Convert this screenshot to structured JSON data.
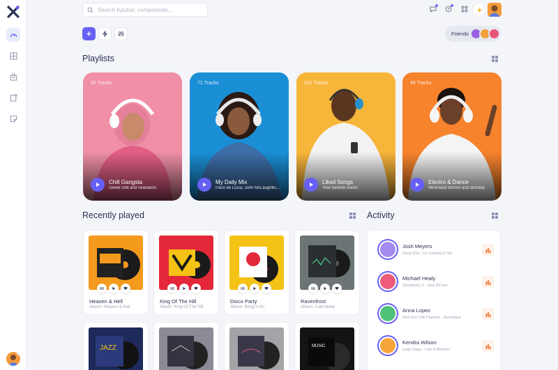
{
  "search": {
    "placeholder": "Search Kputse, components..."
  },
  "header": {
    "friends_label": "Friends"
  },
  "colors": {
    "accent": "#6660f5",
    "background": "#f4f5f9",
    "text": "#283252",
    "muted": "#a2a5b9",
    "eq_orange": "#f07a2d"
  },
  "sidebar": {
    "items": [
      {
        "icon": "gauge-icon",
        "active": true
      },
      {
        "icon": "grid-table-icon",
        "active": false
      },
      {
        "icon": "building-icon",
        "active": false
      },
      {
        "icon": "note-icon",
        "active": false
      },
      {
        "icon": "sticky-note-icon",
        "active": false
      }
    ]
  },
  "toolbar": {
    "icons": [
      "plus-icon",
      "bolt-icon",
      "sliders-icon"
    ]
  },
  "playlists": {
    "title": "Playlists",
    "cards": [
      {
        "tracks": "32 Tracks",
        "name": "Chill Gangsta",
        "sub": "Sweet chill and relaxation",
        "color": "#f08fa6"
      },
      {
        "tracks": "71 Tracks",
        "name": "My Daily Mix",
        "sub": "Paco de Lucia, John McLaughlin,...",
        "color": "#1a8fd6"
      },
      {
        "tracks": "321 Tracks",
        "name": "Liked Songs",
        "sub": "Your favorite tracks",
        "color": "#f7b53a"
      },
      {
        "tracks": "49 Tracks",
        "name": "Electro & Dance",
        "sub": "Minimalist techno and dubstep",
        "color": "#f7832d"
      }
    ]
  },
  "recent": {
    "title": "Recently played",
    "cards": [
      {
        "title": "Heaven & Hell",
        "album": "Album: Heaven & Hell",
        "bg": "#f49a1c"
      },
      {
        "title": "King Of The Hill",
        "album": "Album: King Of The Hill",
        "bg": "#e4283a"
      },
      {
        "title": "Disco Party",
        "album": "Album: Bring It On",
        "bg": "#f5c216"
      },
      {
        "title": "Ravenfrost",
        "album": "Album: Cold Metal",
        "bg": "#6c7476"
      }
    ],
    "more": [
      {
        "bg": "#1f2a5c"
      },
      {
        "bg": "#8b8a95"
      },
      {
        "bg": "#a3a3a8"
      },
      {
        "bg": "#141414"
      }
    ]
  },
  "activity": {
    "title": "Activity",
    "items": [
      {
        "name": "Josh Meyers",
        "song": "Deep Elm - Ice Skating In 5th",
        "color": "#a58bf0"
      },
      {
        "name": "Michael Healy",
        "song": "Symphony X - Sea Of Lies",
        "color": "#ef5b7a"
      },
      {
        "name": "Anna Lopez",
        "song": "Red Hot Chili Peppers - Aeroplane",
        "color": "#4fc27a"
      },
      {
        "name": "Kendra Wilson",
        "song": "Lady Gaga - I am A Monster",
        "color": "#f5a53a"
      }
    ]
  }
}
